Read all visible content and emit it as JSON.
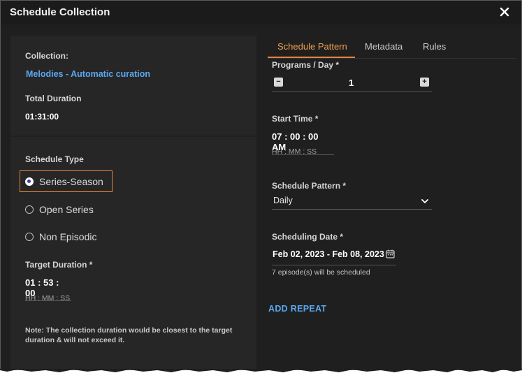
{
  "dialog": {
    "title": "Schedule Collection",
    "close_icon": "close-icon"
  },
  "collection": {
    "label": "Collection:",
    "name": "Melodies - Automatic curation",
    "total_duration_label": "Total Duration",
    "total_duration_value": "01:31:00"
  },
  "schedule_type": {
    "label": "Schedule Type",
    "options": [
      "Series-Season",
      "Open Series",
      "Non Episodic"
    ],
    "selected": "Series-Season"
  },
  "target_duration": {
    "label": "Target Duration *",
    "value": "01 : 53 : 00",
    "format_hint": "HH : MM : SS"
  },
  "note": "Note: The collection duration would be closest to the target duration & will not exceed it.",
  "tabs": [
    {
      "label": "Schedule Pattern",
      "active": true
    },
    {
      "label": "Metadata",
      "active": false
    },
    {
      "label": "Rules",
      "active": false
    }
  ],
  "programs_per_day": {
    "label": "Programs / Day *",
    "value": "1",
    "decrement": "−",
    "increment": "+"
  },
  "start_time": {
    "label": "Start Time *",
    "value": "07 : 00 : 00 AM",
    "format_hint": "HH : MM : SS"
  },
  "schedule_pattern": {
    "label": "Schedule Pattern *",
    "value": "Daily"
  },
  "scheduling_date": {
    "label": "Scheduling Date *",
    "value": "Feb 02, 2023 - Feb 08, 2023",
    "info": "7 episode(s) will be scheduled"
  },
  "add_repeat_label": "ADD REPEAT",
  "colors": {
    "accent": "#e8823a",
    "link": "#5aa8f0",
    "panel": "#262626",
    "background": "#1f1f1f"
  }
}
